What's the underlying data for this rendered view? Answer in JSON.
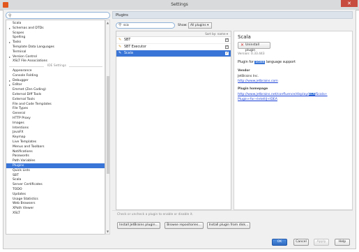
{
  "window": {
    "title": "Settings"
  },
  "left": {
    "search_value": "",
    "items": [
      {
        "label": "Scala",
        "arrow": false
      },
      {
        "label": "Schemas and DTDs",
        "arrow": true
      },
      {
        "label": "Scopes",
        "arrow": false
      },
      {
        "label": "Spelling",
        "arrow": false
      },
      {
        "label": "Tasks",
        "arrow": true
      },
      {
        "label": "Template Data Languages",
        "arrow": false
      },
      {
        "label": "Terminal",
        "arrow": false
      },
      {
        "label": "Version Control",
        "arrow": true
      },
      {
        "label": "XSLT File Associations",
        "arrow": false
      }
    ],
    "separator": "IDE Settings",
    "ide_items": [
      {
        "label": "Appearance",
        "arrow": false
      },
      {
        "label": "Console Folding",
        "arrow": false
      },
      {
        "label": "Debugger",
        "arrow": true
      },
      {
        "label": "Editor",
        "arrow": true
      },
      {
        "label": "Emmet (Zen Coding)",
        "arrow": false
      },
      {
        "label": "External Diff Tools",
        "arrow": false
      },
      {
        "label": "External Tools",
        "arrow": false
      },
      {
        "label": "File and Code Templates",
        "arrow": false
      },
      {
        "label": "File Types",
        "arrow": false
      },
      {
        "label": "General",
        "arrow": false
      },
      {
        "label": "HTTP Proxy",
        "arrow": false
      },
      {
        "label": "Images",
        "arrow": false
      },
      {
        "label": "Intentions",
        "arrow": false
      },
      {
        "label": "JavaFX",
        "arrow": false
      },
      {
        "label": "Keymap",
        "arrow": false
      },
      {
        "label": "Live Templates",
        "arrow": false
      },
      {
        "label": "Menus and Toolbars",
        "arrow": false
      },
      {
        "label": "Notifications",
        "arrow": false
      },
      {
        "label": "Passwords",
        "arrow": false
      },
      {
        "label": "Path Variables",
        "arrow": false
      },
      {
        "label": "Plugins",
        "arrow": false,
        "selected": true
      },
      {
        "label": "Quick Lists",
        "arrow": false
      },
      {
        "label": "SBT",
        "arrow": false
      },
      {
        "label": "Scala",
        "arrow": false
      },
      {
        "label": "Server Certificates",
        "arrow": false
      },
      {
        "label": "TODO",
        "arrow": false
      },
      {
        "label": "Updates",
        "arrow": false
      },
      {
        "label": "Usage Statistics",
        "arrow": false
      },
      {
        "label": "Web Browsers",
        "arrow": false
      },
      {
        "label": "XPath Viewer",
        "arrow": false
      },
      {
        "label": "XSLT",
        "arrow": false
      }
    ]
  },
  "plugins": {
    "header": "Plugins",
    "search_value": "sca",
    "show_label": "Show:",
    "show_value": "All plugins ▾",
    "sort_label": "Sort by: name ▾",
    "rows": [
      {
        "name": "SBT",
        "checked": true,
        "selected": false
      },
      {
        "name": "SBT Executor",
        "checked": true,
        "selected": false
      },
      {
        "name": "Scala",
        "checked": true,
        "selected": true
      }
    ],
    "detail": {
      "title": "Scala",
      "uninstall": "Uninstall plugin",
      "version": "Version: 0.33.443",
      "desc_pre": "Plugin for ",
      "desc_hl": "Scala",
      "desc_post": " language support",
      "vendor_title": "Vendor",
      "vendor_name": "JetBrains Inc.",
      "vendor_link": "http://www.jetbrains.com",
      "home_title": "Plugin homepage",
      "home_link_1": "http://www.jetbrains.net/confluence/display/",
      "home_link_hl": "SCA",
      "home_link_1b": "/Scala+",
      "home_link_2": "Plugin+for+IntelliJ+IDEA"
    },
    "hint": "Check or uncheck a plugin to enable or disable it.",
    "buttons": {
      "install_jb": "Install JetBrains plugin...",
      "browse": "Browse repositories...",
      "from_disk": "Install plugin from disk..."
    }
  },
  "footer": {
    "ok": "OK",
    "cancel": "Cancel",
    "apply": "Apply",
    "help": "Help"
  }
}
